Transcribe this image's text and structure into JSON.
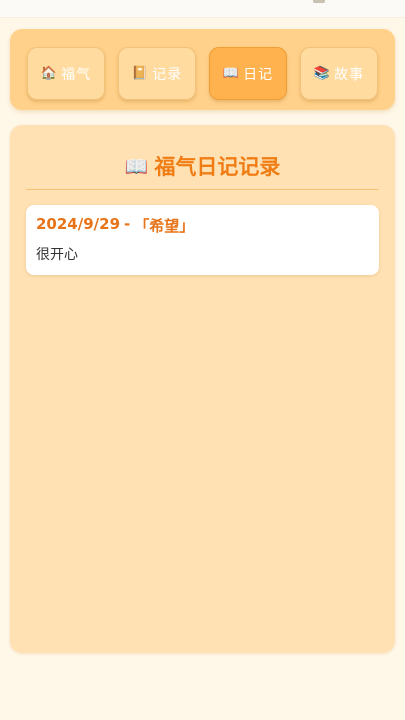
{
  "colors": {
    "background": "#fff7e8",
    "nav_bar": "#ffd18a",
    "nav_button": "#ffdba0",
    "nav_button_active": "#ffb24e",
    "card": "#ffe1b3",
    "accent": "#f07d14"
  },
  "nav": {
    "items": [
      {
        "icon": "🏠",
        "icon_name": "house-icon",
        "label": "福气",
        "active": false
      },
      {
        "icon": "📔",
        "icon_name": "notebook-icon",
        "label": "记录",
        "active": false
      },
      {
        "icon": "📖",
        "icon_name": "open-book-icon",
        "label": "日记",
        "active": true
      },
      {
        "icon": "📚",
        "icon_name": "books-icon",
        "label": "故事",
        "active": false
      }
    ]
  },
  "main": {
    "title_icon": "📖",
    "title_icon_name": "open-book-icon",
    "title": "福气日记记录",
    "entries": [
      {
        "date": "2024/9/29",
        "separator": "-",
        "tag": "「希望」",
        "content": "很开心"
      }
    ]
  }
}
